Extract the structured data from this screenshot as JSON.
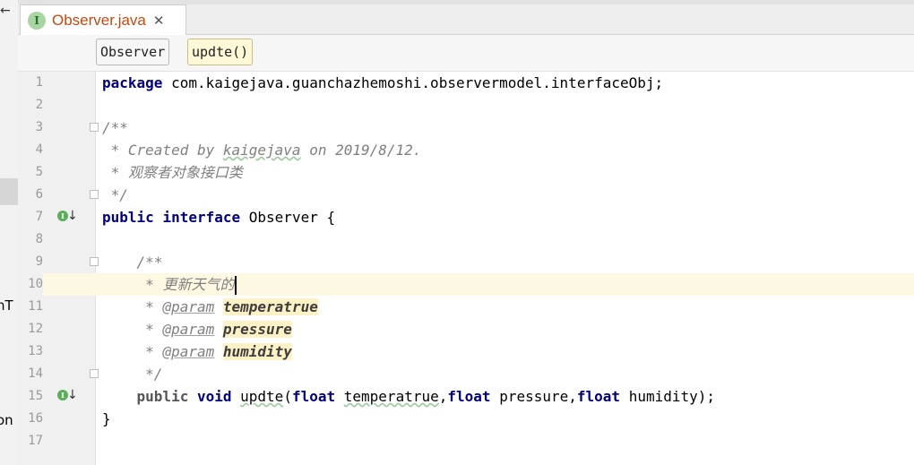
{
  "tab": {
    "title": "Observer.java",
    "icon_letter": "I",
    "close": "✕"
  },
  "breadcrumb": [
    "Observer",
    "updte()"
  ],
  "left_strip": {
    "arrow": "←",
    "frag1": "nT",
    "frag2": "on"
  },
  "gutter": {
    "override_letter": "I",
    "override_arrow": "↓"
  },
  "code": {
    "l1": {
      "num": "1",
      "kw": "package",
      "rest": " com.kaigejava.guanchazhemoshi.observermodel.interfaceObj;"
    },
    "l2": {
      "num": "2"
    },
    "l3": {
      "num": "3",
      "text": "/**"
    },
    "l4": {
      "num": "4",
      "pre": " * Created by ",
      "user": "kaigejava",
      "post": " on 2019/8/12."
    },
    "l5": {
      "num": "5",
      "pre": " * ",
      "cjk": "观察者对象接口类"
    },
    "l6": {
      "num": "6",
      "text": " */"
    },
    "l7": {
      "num": "7",
      "kw1": "public",
      "kw2": "interface",
      "rest": " Observer {"
    },
    "l8": {
      "num": "8"
    },
    "l9": {
      "num": "9",
      "text": "    /**"
    },
    "l10": {
      "num": "10",
      "pre": "     * ",
      "cjk": "更新天气的"
    },
    "l11": {
      "num": "11",
      "pre": "     * ",
      "tag": "@param",
      "param": "temperatrue"
    },
    "l12": {
      "num": "12",
      "pre": "     * ",
      "tag": "@param",
      "param": "pressure"
    },
    "l13": {
      "num": "13",
      "pre": "     * ",
      "tag": "@param",
      "param": "humidity"
    },
    "l14": {
      "num": "14",
      "text": "     */"
    },
    "l15": {
      "num": "15",
      "kw1": "public",
      "kw2": "void",
      "method": "updte",
      "kwf": "float",
      "p1": "temperatrue",
      "p2": "pressure",
      "p3": "humidity"
    },
    "l16": {
      "num": "16",
      "text": "}"
    },
    "l17": {
      "num": "17"
    }
  }
}
